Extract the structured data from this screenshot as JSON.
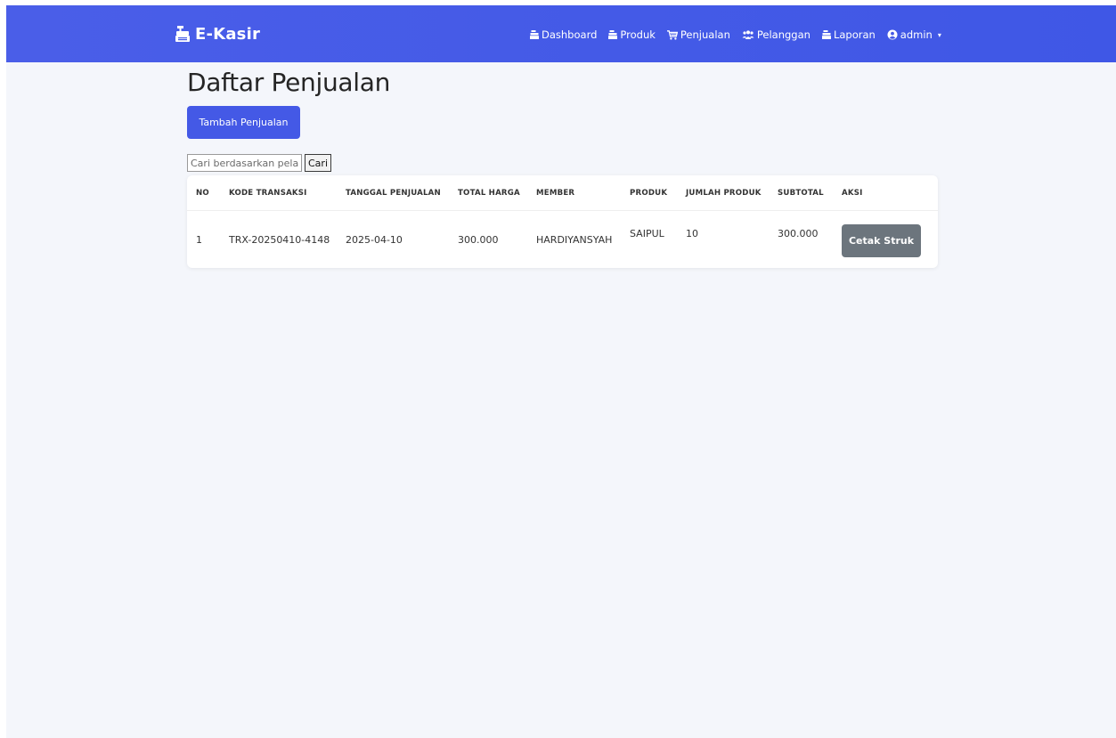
{
  "navbar": {
    "brand": "E-Kasir",
    "brand_icon": "cash-register-icon",
    "items": [
      {
        "label": "Dashboard",
        "icon": "cash-register-icon"
      },
      {
        "label": "Produk",
        "icon": "cash-register-icon"
      },
      {
        "label": "Penjualan",
        "icon": "shopping-cart-icon"
      },
      {
        "label": "Pelanggan",
        "icon": "users-icon"
      },
      {
        "label": "Laporan",
        "icon": "cash-register-icon"
      },
      {
        "label": "admin",
        "icon": "user-circle-icon"
      }
    ],
    "background": "#4459e6"
  },
  "page": {
    "title": "Daftar Penjualan",
    "add_button": "Tambah Penjualan",
    "search": {
      "placeholder": "Cari berdasarkan pelanggan",
      "value": "",
      "button": "Cari"
    }
  },
  "table": {
    "headers": [
      "NO",
      "KODE TRANSAKSI",
      "TANGGAL PENJUALAN",
      "TOTAL HARGA",
      "MEMBER",
      "PRODUK",
      "JUMLAH PRODUK",
      "SUBTOTAL",
      "AKSI"
    ],
    "rows": [
      {
        "no": "1",
        "kode": "TRX-20250410-4148",
        "tanggal": "2025-04-10",
        "total": "300.000",
        "member": "HARDIYANSYAH",
        "produk": "SAIPUL",
        "jumlah": "10",
        "subtotal": "300.000",
        "aksi": "Cetak Struk"
      }
    ]
  },
  "colors": {
    "primary": "#4459e6",
    "secondary": "#6c757d",
    "page_bg": "#f4f6fb"
  }
}
